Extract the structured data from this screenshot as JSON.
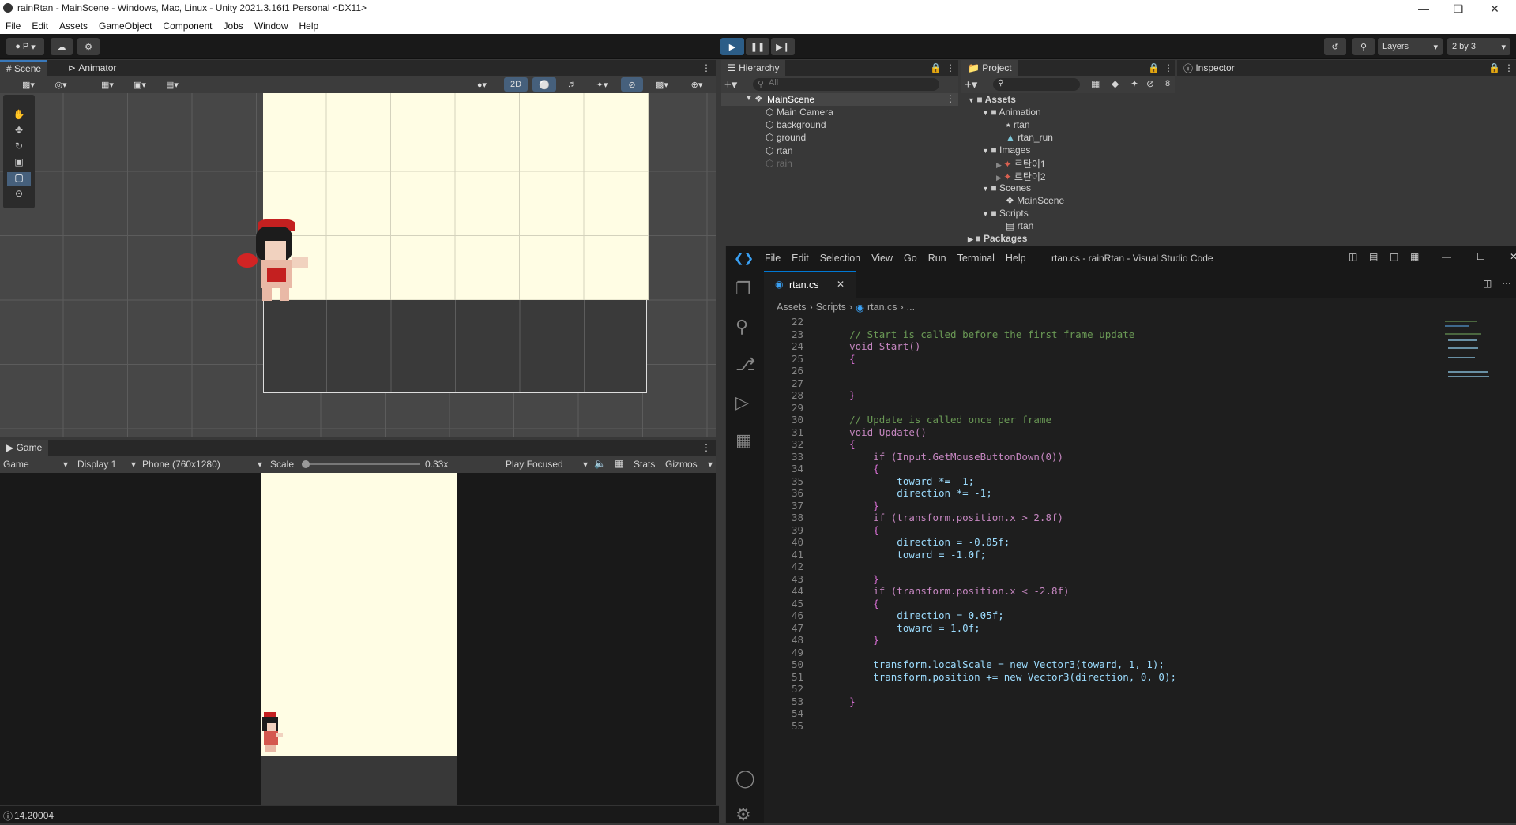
{
  "window": {
    "title": "rainRtan - MainScene - Windows, Mac, Linux - Unity 2021.3.16f1 Personal <DX11>"
  },
  "menu": [
    "File",
    "Edit",
    "Assets",
    "GameObject",
    "Component",
    "Jobs",
    "Window",
    "Help"
  ],
  "toolbar": {
    "account": "P",
    "layers": "Layers",
    "layout": "2 by 3"
  },
  "scene_tabs": [
    "Scene",
    "Animator"
  ],
  "scene_toolbar": {
    "mode_2d": "2D"
  },
  "hierarchy": {
    "title": "Hierarchy",
    "search_placeholder": "All",
    "scene": "MainScene",
    "items": [
      "Main Camera",
      "background",
      "ground",
      "rtan",
      "rain"
    ]
  },
  "project": {
    "title": "Project",
    "count": "8",
    "tree": [
      {
        "label": "Assets",
        "depth": 0,
        "type": "folder"
      },
      {
        "label": "Animation",
        "depth": 1,
        "type": "folder"
      },
      {
        "label": "rtan",
        "depth": 2,
        "type": "anim"
      },
      {
        "label": "rtan_run",
        "depth": 2,
        "type": "clip"
      },
      {
        "label": "Images",
        "depth": 1,
        "type": "folder"
      },
      {
        "label": "르탄이1",
        "depth": 2,
        "type": "sprite"
      },
      {
        "label": "르탄이2",
        "depth": 2,
        "type": "sprite"
      },
      {
        "label": "Scenes",
        "depth": 1,
        "type": "folder"
      },
      {
        "label": "MainScene",
        "depth": 2,
        "type": "scene"
      },
      {
        "label": "Scripts",
        "depth": 1,
        "type": "folder"
      },
      {
        "label": "rtan",
        "depth": 2,
        "type": "script"
      },
      {
        "label": "Packages",
        "depth": 0,
        "type": "folder"
      }
    ]
  },
  "inspector": {
    "title": "Inspector"
  },
  "game": {
    "tab": "Game",
    "mode": "Game",
    "display": "Display 1",
    "resolution": "Phone (760x1280)",
    "scale_label": "Scale",
    "scale_value": "0.33x",
    "play_mode": "Play Focused",
    "stats": "Stats",
    "gizmos": "Gizmos"
  },
  "status": {
    "value": "14.20004"
  },
  "vscode": {
    "menu": [
      "File",
      "Edit",
      "Selection",
      "View",
      "Go",
      "Run",
      "Terminal",
      "Help"
    ],
    "title": "rtan.cs - rainRtan - Visual Studio Code",
    "tab": "rtan.cs",
    "breadcrumb": [
      "Assets",
      "Scripts",
      "rtan.cs",
      "..."
    ],
    "lines": [
      {
        "n": "22",
        "t": ""
      },
      {
        "n": "23",
        "t": "    // Start is called before the first frame update"
      },
      {
        "n": "24",
        "t": "    void Start()"
      },
      {
        "n": "25",
        "t": "    {"
      },
      {
        "n": "26",
        "t": ""
      },
      {
        "n": "27",
        "t": ""
      },
      {
        "n": "28",
        "t": "    }"
      },
      {
        "n": "29",
        "t": ""
      },
      {
        "n": "30",
        "t": "    // Update is called once per frame"
      },
      {
        "n": "31",
        "t": "    void Update()"
      },
      {
        "n": "32",
        "t": "    {"
      },
      {
        "n": "33",
        "t": "        if (Input.GetMouseButtonDown(0))"
      },
      {
        "n": "34",
        "t": "        {"
      },
      {
        "n": "35",
        "t": "            toward *= -1;"
      },
      {
        "n": "36",
        "t": "            direction *= -1;"
      },
      {
        "n": "37",
        "t": "        }"
      },
      {
        "n": "38",
        "t": "        if (transform.position.x > 2.8f)"
      },
      {
        "n": "39",
        "t": "        {"
      },
      {
        "n": "40",
        "t": "            direction = -0.05f;"
      },
      {
        "n": "41",
        "t": "            toward = -1.0f;"
      },
      {
        "n": "42",
        "t": ""
      },
      {
        "n": "43",
        "t": "        }"
      },
      {
        "n": "44",
        "t": "        if (transform.position.x < -2.8f)"
      },
      {
        "n": "45",
        "t": "        {"
      },
      {
        "n": "46",
        "t": "            direction = 0.05f;"
      },
      {
        "n": "47",
        "t": "            toward = 1.0f;"
      },
      {
        "n": "48",
        "t": "        }"
      },
      {
        "n": "49",
        "t": ""
      },
      {
        "n": "50",
        "t": "        transform.localScale = new Vector3(toward, 1, 1);"
      },
      {
        "n": "51",
        "t": "        transform.position += new Vector3(direction, 0, 0);"
      },
      {
        "n": "52",
        "t": ""
      },
      {
        "n": "53",
        "t": "    }"
      },
      {
        "n": "54",
        "t": ""
      },
      {
        "n": "55",
        "t": ""
      }
    ]
  }
}
